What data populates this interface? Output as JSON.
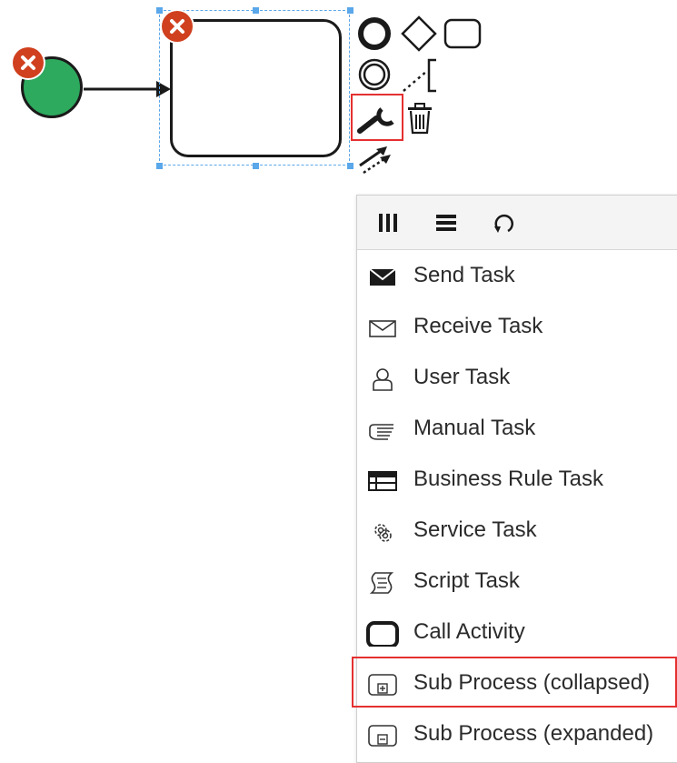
{
  "context_pad": {
    "icons": [
      "end-event-icon",
      "gateway-icon",
      "task-icon",
      "intermediate-event-icon",
      "text-annotation-icon",
      "change-type-wrench-icon",
      "delete-trash-icon",
      "connect-arrow-icon"
    ]
  },
  "popup": {
    "header_icons": [
      "parallel-multi-instance-icon",
      "sequential-multi-instance-icon",
      "loop-icon"
    ],
    "items": [
      {
        "label": "Send Task",
        "icon": "send-task-icon"
      },
      {
        "label": "Receive Task",
        "icon": "receive-task-icon"
      },
      {
        "label": "User Task",
        "icon": "user-task-icon"
      },
      {
        "label": "Manual Task",
        "icon": "manual-task-icon"
      },
      {
        "label": "Business Rule Task",
        "icon": "business-rule-task-icon"
      },
      {
        "label": "Service Task",
        "icon": "service-task-icon"
      },
      {
        "label": "Script Task",
        "icon": "script-task-icon"
      },
      {
        "label": "Call Activity",
        "icon": "call-activity-icon"
      },
      {
        "label": "Sub Process (collapsed)",
        "icon": "sub-process-collapsed-icon"
      },
      {
        "label": "Sub Process (expanded)",
        "icon": "sub-process-expanded-icon"
      }
    ]
  },
  "colors": {
    "start_event": "#2daa5e",
    "error_badge": "#d0401e",
    "selection": "#5aa7ea",
    "highlight": "#e53030"
  }
}
